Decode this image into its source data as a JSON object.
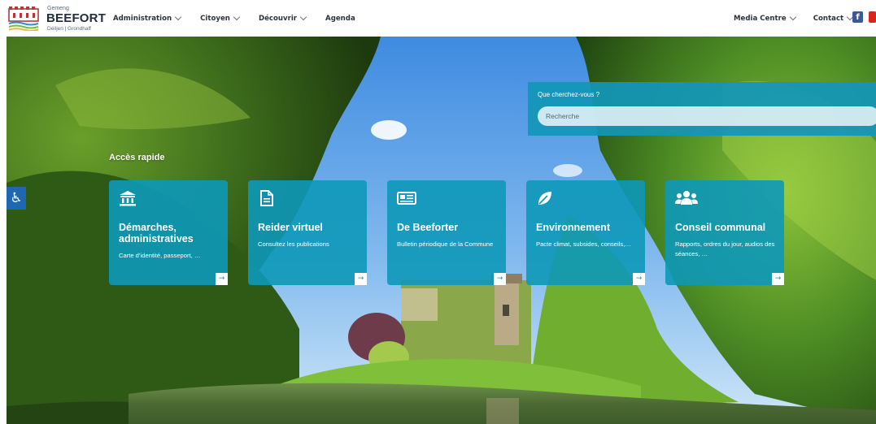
{
  "header": {
    "logo": {
      "small": "Gemeng",
      "name": "BEEFORT",
      "sub": "Déiljen | Grondhaff"
    },
    "nav_left": [
      {
        "label": "Administration",
        "dropdown": true
      },
      {
        "label": "Citoyen",
        "dropdown": true
      },
      {
        "label": "Découvrir",
        "dropdown": true
      },
      {
        "label": "Agenda",
        "dropdown": false
      }
    ],
    "nav_right": [
      {
        "label": "Media Centre",
        "dropdown": true
      },
      {
        "label": "Contact",
        "dropdown": true
      }
    ],
    "social": {
      "facebook": "f",
      "youtube_color": "#d9251c",
      "facebook_color": "#3b5998"
    }
  },
  "accessibility": {
    "icon": "♿",
    "color": "#1f66b3"
  },
  "search": {
    "label": "Que cherchez-vous ?",
    "placeholder": "Recherche"
  },
  "quick_access": {
    "title": "Accès rapide",
    "cards": [
      {
        "icon": "bank-icon",
        "title": "Démarches, administratives",
        "desc": "Carte d’identité, passeport, …"
      },
      {
        "icon": "document-icon",
        "title": "Reider virtuel",
        "desc": "Consultez les publications"
      },
      {
        "icon": "newspaper-icon",
        "title": "De Beeforter",
        "desc": "Bulletin périodique de la Commune"
      },
      {
        "icon": "leaf-icon",
        "title": "Environnement",
        "desc": "Pacte climat, subsides, conseils,…"
      },
      {
        "icon": "users-icon",
        "title": "Conseil communal",
        "desc": "Rapports, ordres du jour, audios des séances, …"
      }
    ],
    "arrow": "→"
  },
  "colors": {
    "card": "#0d98b8",
    "accent": "#1f66b3"
  }
}
